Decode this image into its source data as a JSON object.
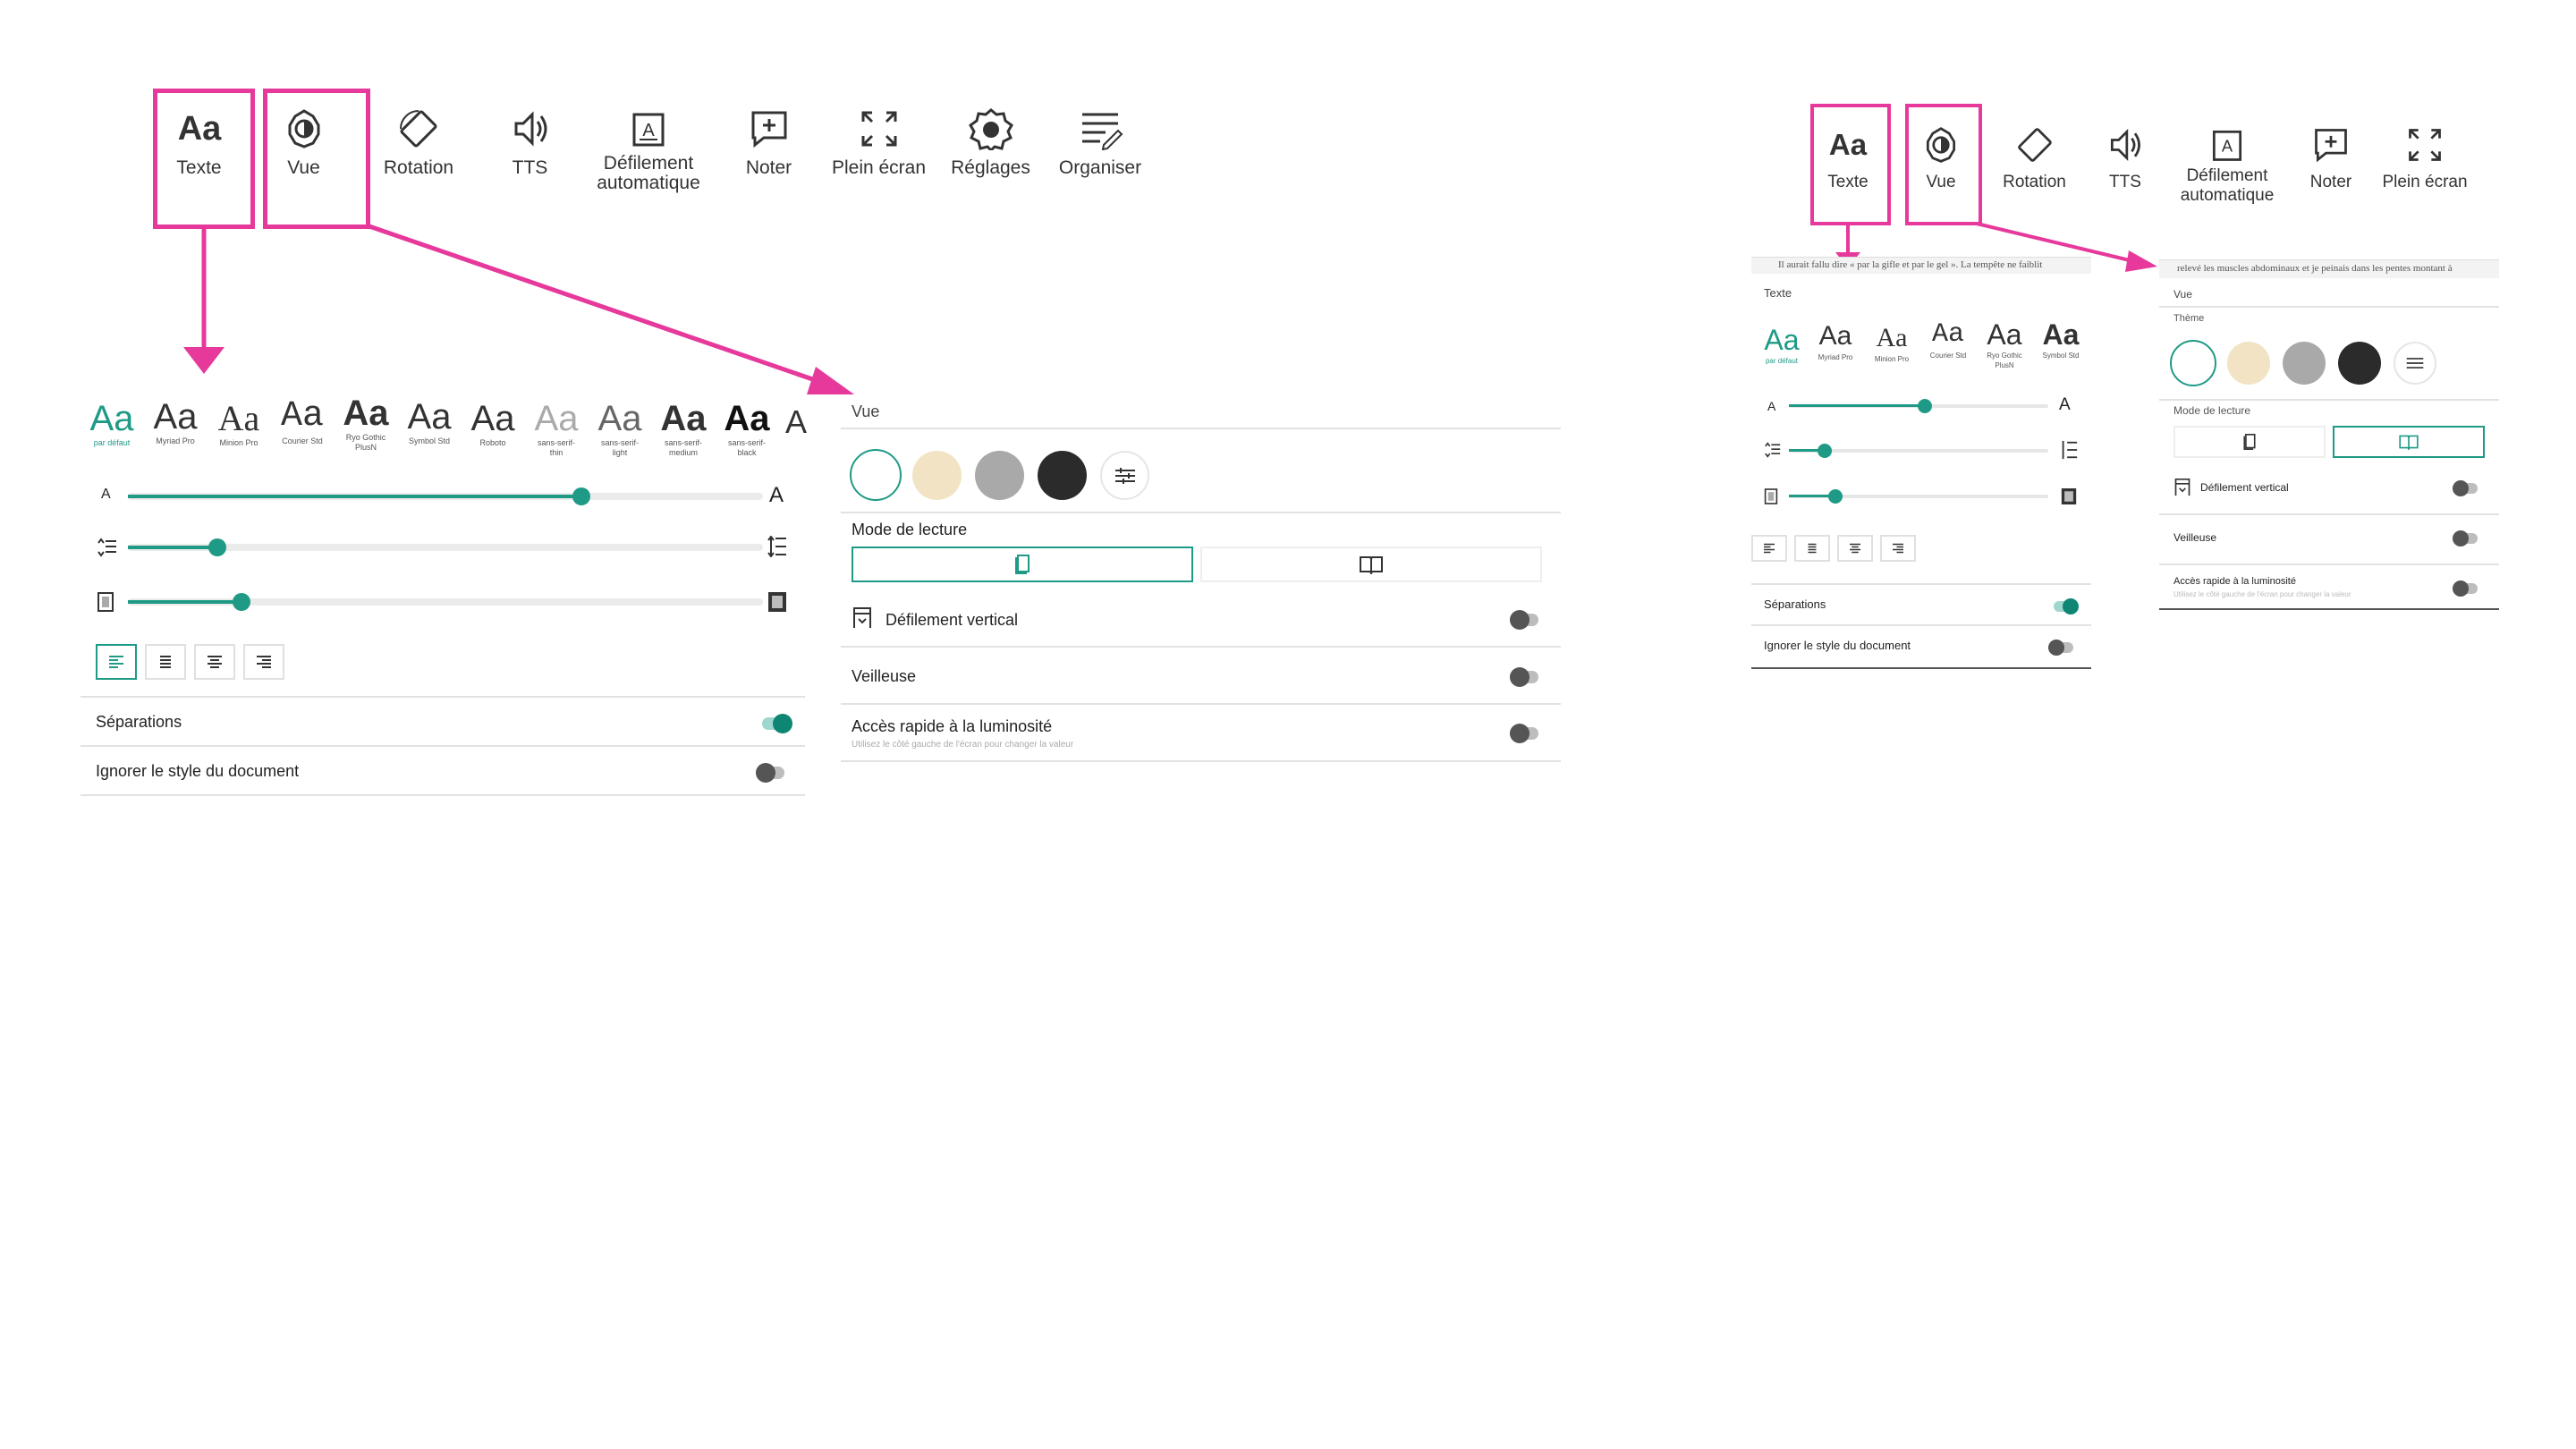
{
  "toolbar_large": {
    "items": [
      {
        "label": "Texte",
        "icon": "text-aa-icon"
      },
      {
        "label": "Vue",
        "icon": "brightness-icon"
      },
      {
        "label": "Rotation",
        "icon": "rotation-icon"
      },
      {
        "label": "TTS",
        "icon": "speaker-icon"
      },
      {
        "label": "Défilement\nautomatique",
        "icon": "auto-scroll-icon"
      },
      {
        "label": "Noter",
        "icon": "add-note-icon"
      },
      {
        "label": "Plein écran",
        "icon": "fullscreen-icon"
      },
      {
        "label": "Réglages",
        "icon": "gear-icon"
      },
      {
        "label": "Organiser",
        "icon": "organize-icon"
      }
    ]
  },
  "toolbar_small": {
    "items": [
      {
        "label": "Texte",
        "icon": "text-aa-icon"
      },
      {
        "label": "Vue",
        "icon": "brightness-icon"
      },
      {
        "label": "Rotation",
        "icon": "rotation-icon"
      },
      {
        "label": "TTS",
        "icon": "speaker-icon"
      },
      {
        "label": "Défilement\nautomatique",
        "icon": "auto-scroll-icon"
      },
      {
        "label": "Noter",
        "icon": "add-note-icon"
      },
      {
        "label": "Plein écran",
        "icon": "fullscreen-icon"
      }
    ]
  },
  "text_panel": {
    "title": "Texte",
    "fonts": [
      {
        "sample": "Aa",
        "name": "par défaut",
        "selected": true
      },
      {
        "sample": "Aa",
        "name": "Myriad Pro"
      },
      {
        "sample": "Aa",
        "name": "Minion Pro"
      },
      {
        "sample": "Aa",
        "name": "Courier Std"
      },
      {
        "sample": "Aa",
        "name": "Ryo Gothic PlusN"
      },
      {
        "sample": "Aa",
        "name": "Symbol Std"
      },
      {
        "sample": "Aa",
        "name": "Roboto"
      },
      {
        "sample": "Aa",
        "name": "sans-serif-thin"
      },
      {
        "sample": "Aa",
        "name": "sans-serif-light"
      },
      {
        "sample": "Aa",
        "name": "sans-serif-medium"
      },
      {
        "sample": "Aa",
        "name": "sans-serif-black"
      }
    ],
    "size_label_small": "A",
    "size_label_large": "A",
    "font_size_level": 0.7,
    "line_spacing_level": 0.14,
    "margin_level": 0.18,
    "separations_label": "Séparations",
    "separations_on": true,
    "ignore_style_label": "Ignorer le style du document",
    "ignore_style_on": false
  },
  "view_panel": {
    "title": "Vue",
    "theme_label": "Thème",
    "themes": [
      "#ffffff",
      "#f1e3c4",
      "#a9a9a9",
      "#2b2b2b"
    ],
    "reading_mode_label": "Mode de lecture",
    "vertical_scroll_label": "Défilement vertical",
    "nightlight_label": "Veilleuse",
    "brightness_label": "Accès rapide à la luminosité",
    "brightness_hint": "Utilisez le côté gauche de l'écran pour changer la valeur"
  },
  "book_snippets": {
    "left": "Il aurait fallu dire « par la gifle et par le gel ». La tempête ne faiblit",
    "right": "relevé les muscles abdominaux et je peinais dans les pentes montant à"
  },
  "colors": {
    "accent": "#1f9a86",
    "highlight": "#e6399b"
  }
}
